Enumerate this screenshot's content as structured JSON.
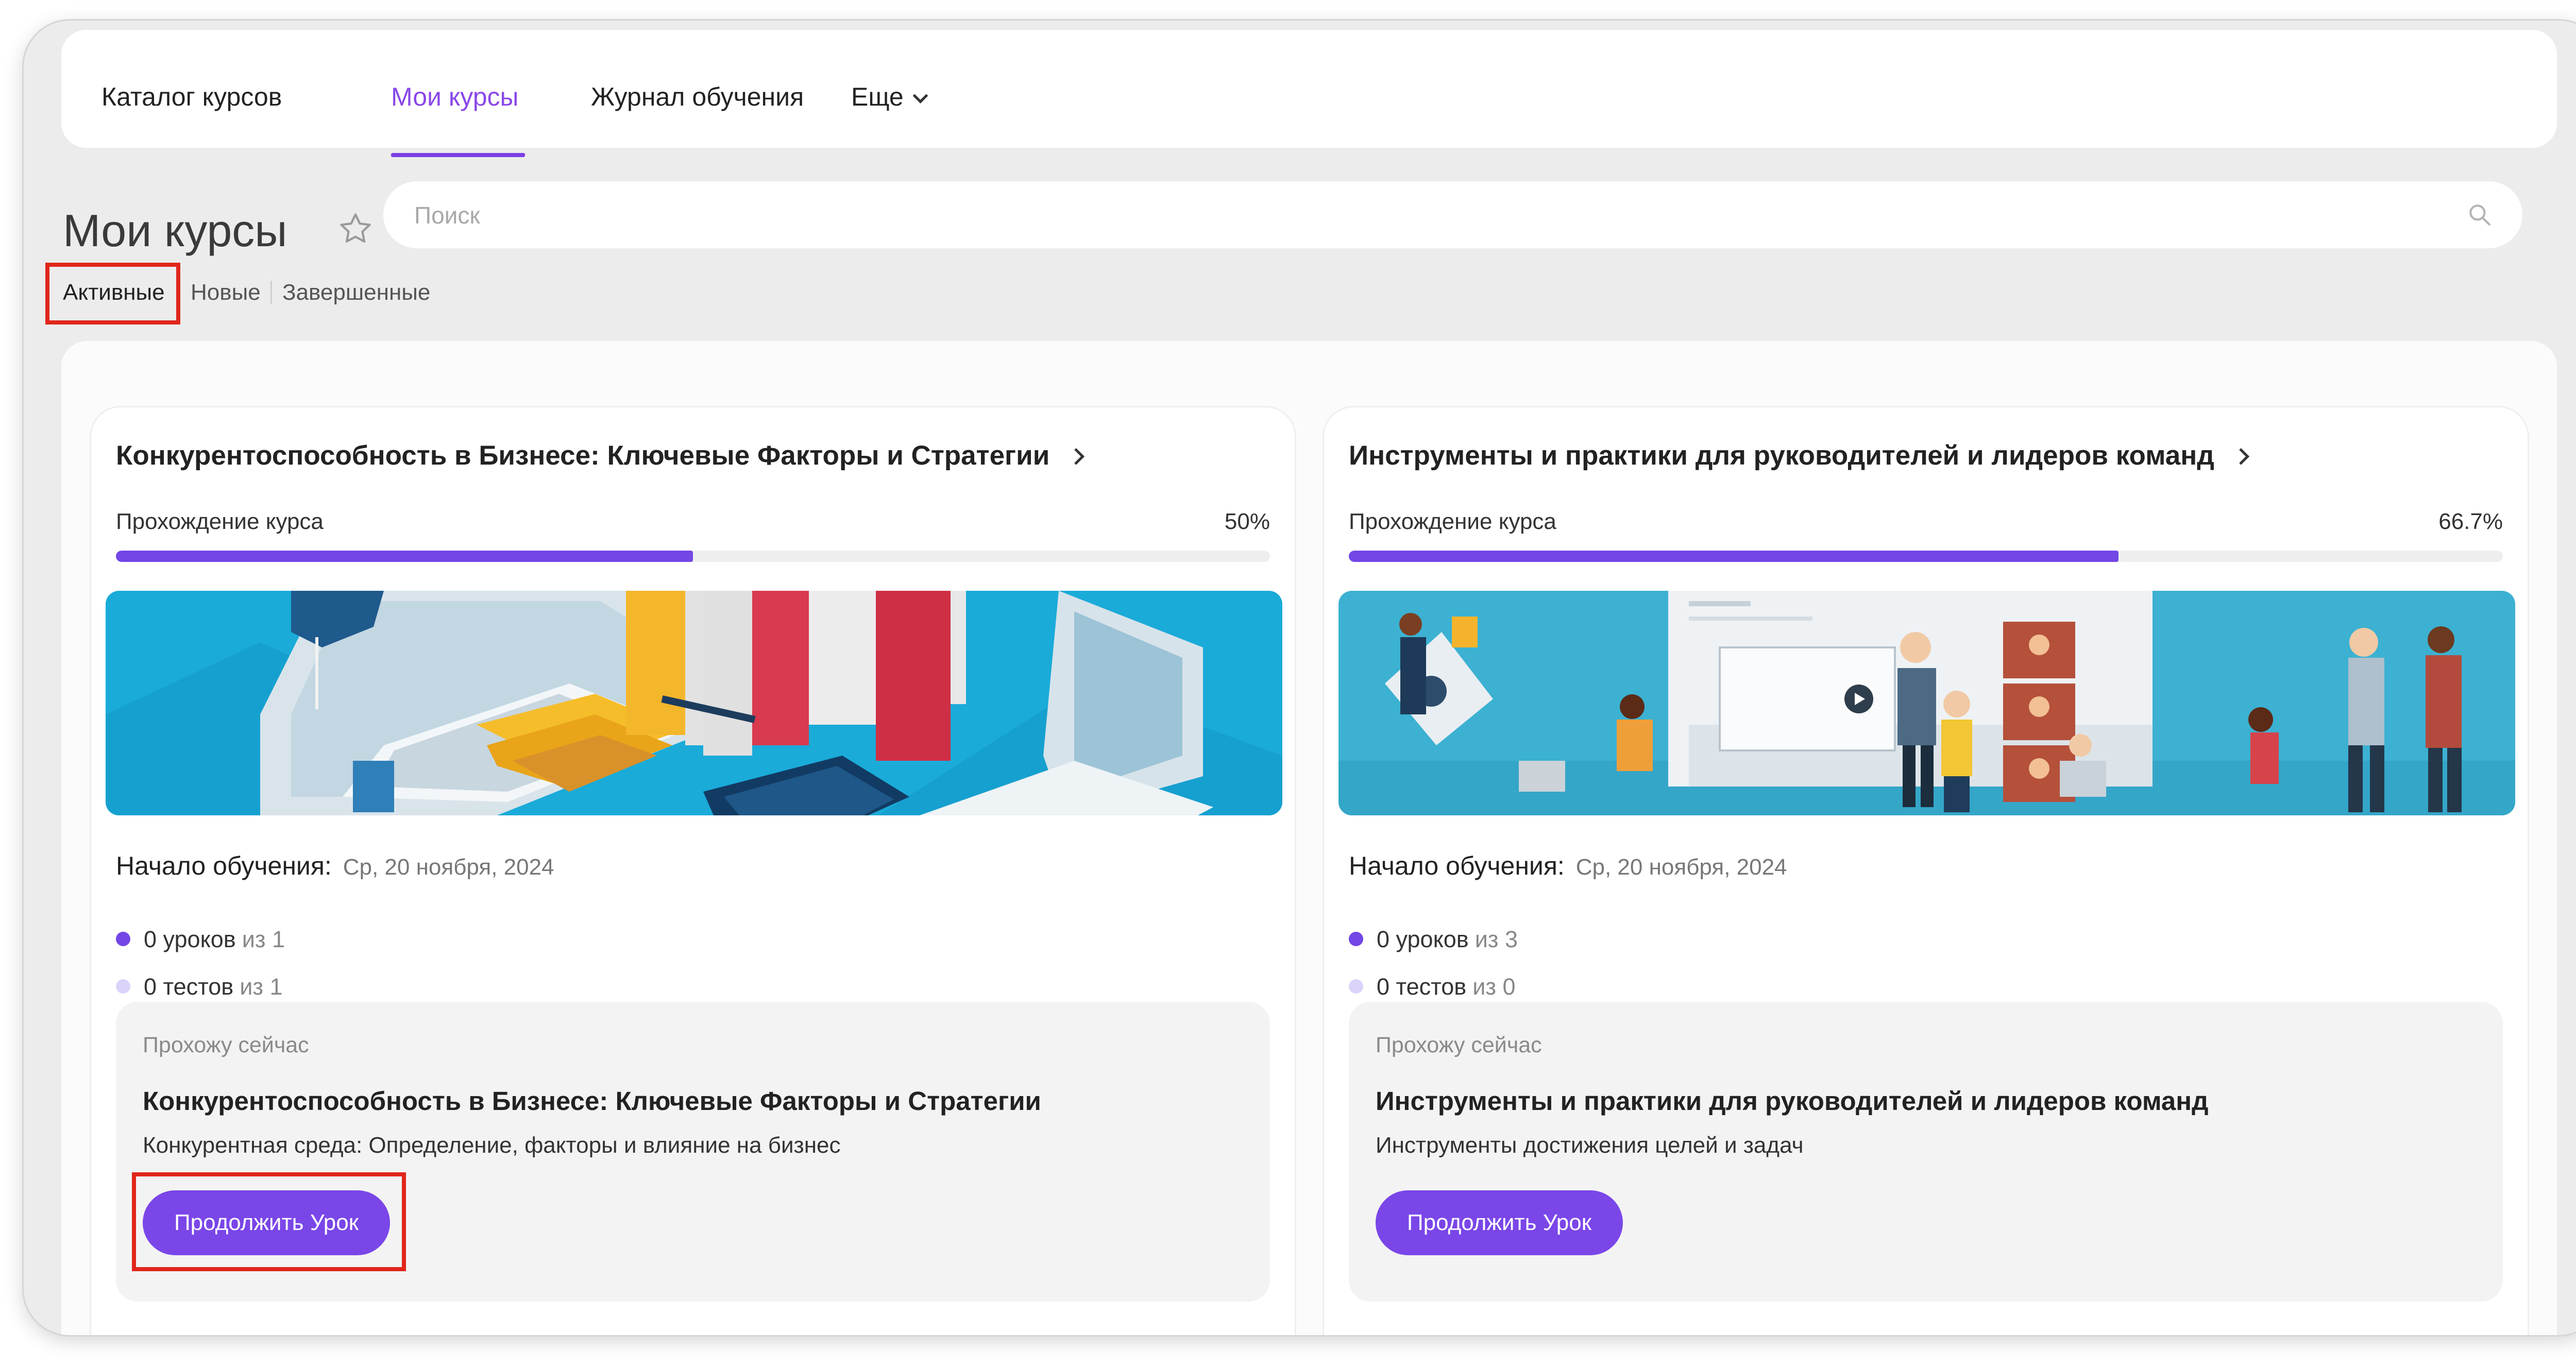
{
  "nav": {
    "tabs": [
      {
        "label": "Каталог курсов"
      },
      {
        "label": "Мои курсы"
      },
      {
        "label": "Журнал обучения"
      },
      {
        "label": "Еще"
      }
    ]
  },
  "header": {
    "title": "Мои курсы"
  },
  "search": {
    "placeholder": "Поиск"
  },
  "filters": [
    {
      "label": "Активные"
    },
    {
      "label": "Новые"
    },
    {
      "label": "Завершенные"
    }
  ],
  "courses": [
    {
      "title": "Конкурентоспособность в Бизнесе: Ключевые Факторы и Стратегии",
      "progress_label": "Прохождение курса",
      "progress_text": "50%",
      "progress_fraction": 0.5,
      "start_label": "Начало обучения:",
      "start_date": "Ср, 20 ноября, 2024",
      "lessons_done": "0 уроков",
      "lessons_total": "из 1",
      "tests_done": "0 тестов",
      "tests_total": "из 1",
      "current_label": "Прохожу сейчас",
      "current_title": "Конкурентоспособность в Бизнесе: Ключевые Факторы и Стратегии",
      "current_lesson": "Конкурентная среда: Определение, факторы и влияние на бизнес",
      "button_label": "Продолжить Урок"
    },
    {
      "title": "Инструменты и практики для руководителей и лидеров команд",
      "progress_label": "Прохождение курса",
      "progress_text": "66.7%",
      "progress_fraction": 0.667,
      "start_label": "Начало обучения:",
      "start_date": "Ср, 20 ноября, 2024",
      "lessons_done": "0 уроков",
      "lessons_total": "из 3",
      "tests_done": "0 тестов",
      "tests_total": "из 0",
      "current_label": "Прохожу сейчас",
      "current_title": "Инструменты и практики для руководителей и лидеров команд",
      "current_lesson": "Инструменты достижения целей и задач",
      "button_label": "Продолжить Урок"
    }
  ],
  "colors": {
    "accent": "#7a46e8",
    "accent_text": "#8a48e8",
    "dot_lessons": "#7346e6",
    "dot_tests": "#dcd3fb",
    "highlight": "#e0261b"
  },
  "icons": {
    "favorite": "star-icon",
    "search": "search-icon",
    "more": "chevron-down-icon",
    "open": "chevron-right-icon"
  }
}
